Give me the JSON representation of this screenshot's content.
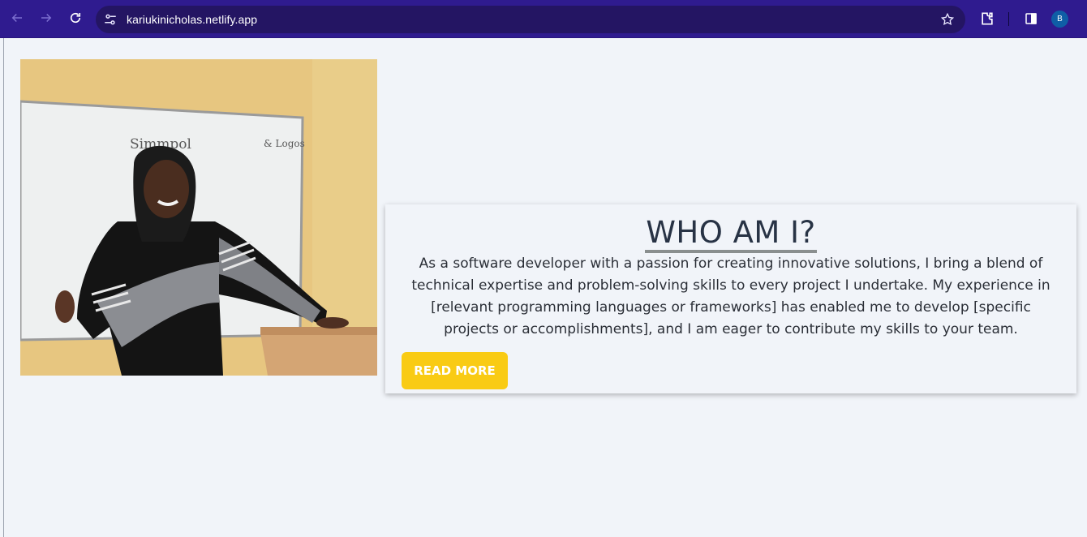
{
  "browser": {
    "url": "kariukinicholas.netlify.app",
    "profile_initial": "B",
    "colors": {
      "chrome": "#2f1b8f",
      "omnibox": "#241563"
    }
  },
  "about": {
    "title": "WHO AM I?",
    "body": "As a software developer with a passion for creating innovative solutions, I bring a blend of technical expertise and problem-solving skills to every project I undertake. My experience in [relevant programming languages or frameworks] has enabled me to develop [specific projects or accomplishments], and I am eager to contribute my skills to your team.",
    "button_label": "READ MORE",
    "colors": {
      "button": "#f9cb14",
      "title": "#283345"
    }
  },
  "photo": {
    "whiteboard_text": "Simmpol ... & Logos"
  }
}
